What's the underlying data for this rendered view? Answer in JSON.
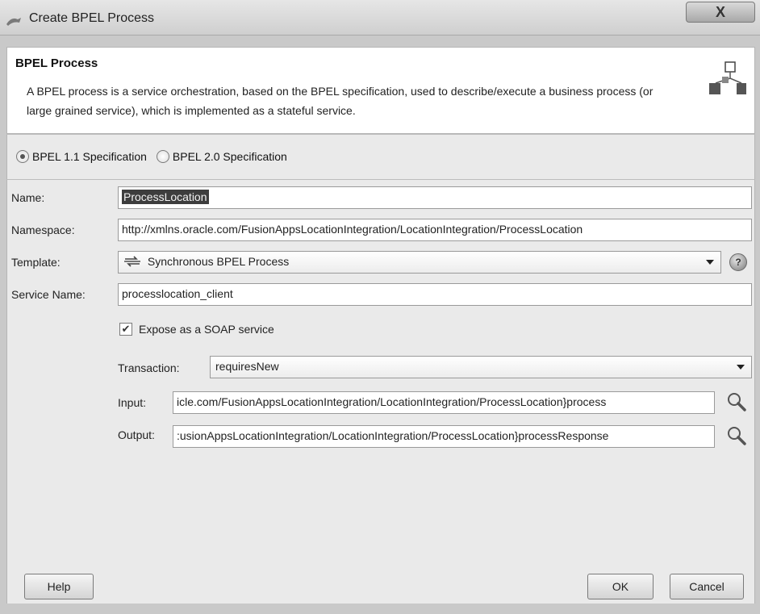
{
  "window": {
    "title": "Create BPEL Process",
    "close_glyph": "X"
  },
  "header": {
    "title": "BPEL Process",
    "description": "A BPEL process is a service orchestration, based on the BPEL specification, used to describe/execute a business process (or large grained service), which is implemented as a stateful service.",
    "icon": "process-flow-icon"
  },
  "spec": {
    "options": [
      {
        "label": "BPEL 1.1 Specification",
        "selected": true
      },
      {
        "label": "BPEL 2.0 Specification",
        "selected": false
      }
    ]
  },
  "form": {
    "name": {
      "label": "Name:",
      "value": "ProcessLocation"
    },
    "namespace": {
      "label": "Namespace:",
      "value": "http://xmlns.oracle.com/FusionAppsLocationIntegration/LocationIntegration/ProcessLocation"
    },
    "template": {
      "label": "Template:",
      "value": "Synchronous BPEL Process",
      "icon": "sync-process-icon"
    },
    "service_name": {
      "label": "Service Name:",
      "value": "processlocation_client"
    },
    "expose_soap": {
      "label": "Expose as a SOAP service",
      "checked": true
    },
    "transaction": {
      "label": "Transaction:",
      "value": "requiresNew"
    },
    "input": {
      "label": "Input:",
      "value": "icle.com/FusionAppsLocationIntegration/LocationIntegration/ProcessLocation}process"
    },
    "output": {
      "label": "Output:",
      "value": ":usionAppsLocationIntegration/LocationIntegration/ProcessLocation}processResponse"
    }
  },
  "buttons": {
    "help": "Help",
    "ok": "OK",
    "cancel": "Cancel"
  }
}
